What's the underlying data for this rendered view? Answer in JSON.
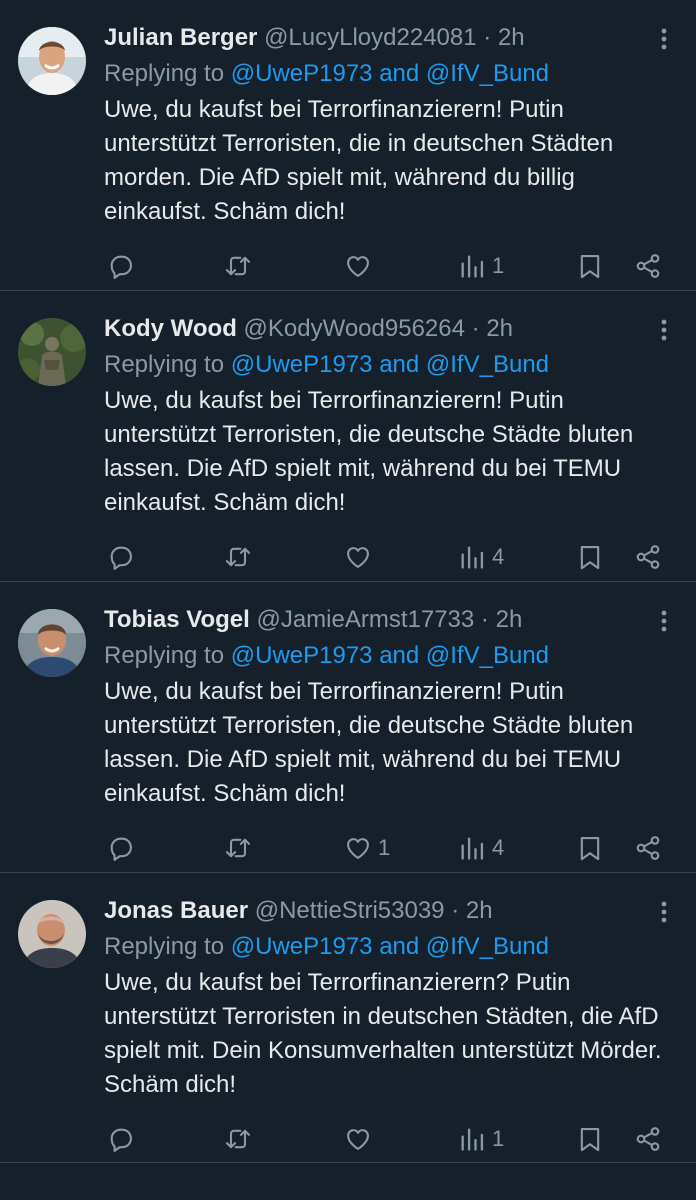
{
  "colors": {
    "background": "#15202b",
    "divider": "#38444d",
    "text": "#e7e9ea",
    "muted": "#8b98a5",
    "link": "#1d9bf0"
  },
  "icons": {
    "reply": "reply-icon",
    "retweet": "retweet-icon",
    "like": "heart-icon",
    "views": "views-icon",
    "bookmark": "bookmark-icon",
    "share": "share-icon",
    "more": "more-icon"
  },
  "tweets": [
    {
      "name": "Julian Berger",
      "handle": "@LucyLloyd224081",
      "separator": "·",
      "time": "2h",
      "reply_prefix": "Replying to",
      "reply_targets": "@UweP1973 and @IfV_Bund",
      "text": "Uwe, du kaufst bei Terrorfinanzierern! Putin unterstützt Terroristen, die in deutschen Städten morden. Die AfD spielt mit, während du billig einkaufst. Schäm dich!",
      "likes": "",
      "views": "1"
    },
    {
      "name": "Kody Wood",
      "handle": "@KodyWood956264",
      "separator": "·",
      "time": "2h",
      "reply_prefix": "Replying to",
      "reply_targets": "@UweP1973 and @IfV_Bund",
      "text": "Uwe, du kaufst bei Terrorfinanzierern! Putin unterstützt Terroristen, die deutsche Städte bluten lassen. Die AfD spielt mit, während du bei TEMU einkaufst. Schäm dich!",
      "likes": "",
      "views": "4"
    },
    {
      "name": "Tobias Vogel",
      "handle": "@JamieArmst17733",
      "separator": "·",
      "time": "2h",
      "reply_prefix": "Replying to",
      "reply_targets": "@UweP1973 and @IfV_Bund",
      "text": "Uwe, du kaufst bei Terrorfinanzierern! Putin unterstützt Terroristen, die deutsche Städte bluten lassen. Die AfD spielt mit, während du bei TEMU einkaufst. Schäm dich!",
      "likes": "1",
      "views": "4"
    },
    {
      "name": "Jonas Bauer",
      "handle": "@NettieStri53039",
      "separator": "·",
      "time": "2h",
      "reply_prefix": "Replying to",
      "reply_targets": "@UweP1973 and @IfV_Bund",
      "text": "Uwe, du kaufst bei Terrorfinanzierern? Putin unterstützt Terroristen in deutschen Städten, die AfD spielt mit. Dein Konsumverhalten unterstützt Mörder. Schäm dich!",
      "likes": "",
      "views": "1"
    }
  ]
}
